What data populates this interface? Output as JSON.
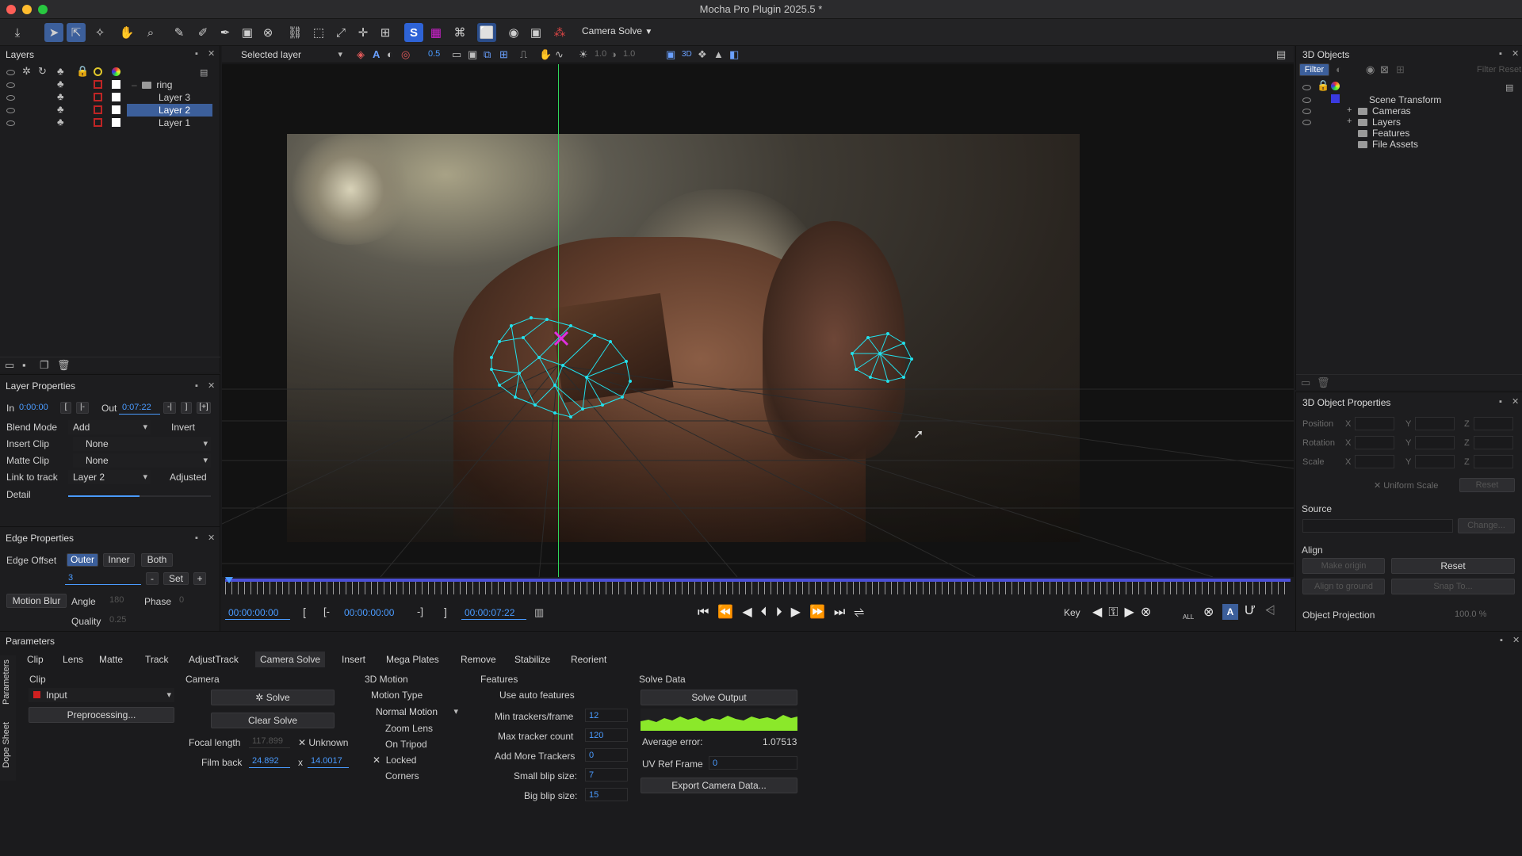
{
  "window": {
    "title": "Mocha Pro Plugin 2025.5 *"
  },
  "toolbar": {
    "module_select": "Camera Solve"
  },
  "viewer_bar": {
    "layer_select": "Selected layer",
    "opacity": "0.5",
    "val1": "1.0",
    "val2": "1.0"
  },
  "layers_panel": {
    "title": "Layers",
    "group": "ring",
    "layers": [
      {
        "name": "Layer 3",
        "selected": false
      },
      {
        "name": "Layer 2",
        "selected": true
      },
      {
        "name": "Layer 1",
        "selected": false
      }
    ]
  },
  "layer_properties": {
    "title": "Layer Properties",
    "in_label": "In",
    "in_value": "0:00:00",
    "out_label": "Out",
    "out_value": "0:07:22",
    "blend_mode_label": "Blend Mode",
    "blend_mode": "Add",
    "invert_label": "Invert",
    "insert_clip_label": "Insert Clip",
    "insert_clip": "None",
    "matte_clip_label": "Matte Clip",
    "matte_clip": "None",
    "link_label": "Link to track",
    "link_value": "Layer 2",
    "adjusted_label": "Adjusted",
    "detail_label": "Detail"
  },
  "edge_properties": {
    "title": "Edge Properties",
    "edge_offset_label": "Edge Offset",
    "outer": "Outer",
    "inner": "Inner",
    "both": "Both",
    "offset_value": "3",
    "minus": "-",
    "set": "Set",
    "plus": "+",
    "motion_blur": "Motion Blur",
    "angle_label": "Angle",
    "angle_value": "180",
    "phase_label": "Phase",
    "phase_value": "0",
    "quality_label": "Quality",
    "quality_value": "0.25"
  },
  "timeline": {
    "current": "00:00:00:00",
    "in": "00:00:00:00",
    "out": "00:00:07:22",
    "key_label": "Key",
    "all_label": "ALL"
  },
  "objects_3d": {
    "title": "3D Objects",
    "filter": "Filter",
    "filter_reset": "Filter Reset",
    "tree": [
      {
        "name": "Scene Transform",
        "level": 0
      },
      {
        "name": "Cameras",
        "level": 1
      },
      {
        "name": "Layers",
        "level": 1
      },
      {
        "name": "Features",
        "level": 1
      },
      {
        "name": "File Assets",
        "level": 1
      }
    ]
  },
  "object_properties": {
    "title": "3D Object Properties",
    "position": "Position",
    "rotation": "Rotation",
    "scale": "Scale",
    "x": "X",
    "y": "Y",
    "z": "Z",
    "uniform_scale": "Uniform Scale",
    "reset": "Reset",
    "source_label": "Source",
    "change": "Change...",
    "align_label": "Align",
    "make_origin": "Make origin",
    "align_reset": "Reset",
    "align_to_ground": "Align to ground",
    "snap_to": "Snap To...",
    "projection_label": "Object Projection",
    "projection_value": "100.0 %"
  },
  "parameters": {
    "title": "Parameters",
    "side_tabs": [
      "Parameters",
      "Dope Sheet"
    ],
    "tabs": [
      "Clip",
      "Lens",
      "Matte",
      "Track",
      "AdjustTrack",
      "Camera Solve",
      "Insert",
      "Mega Plates",
      "Remove",
      "Stabilize",
      "Reorient"
    ],
    "active_tab": "Camera Solve",
    "clip": {
      "label": "Clip",
      "input": "Input",
      "preprocessing": "Preprocessing..."
    },
    "camera": {
      "label": "Camera",
      "solve": "Solve",
      "clear": "Clear Solve",
      "focal_label": "Focal length",
      "focal_value": "117.899",
      "unknown": "Unknown",
      "film_label": "Film back",
      "film_w": "24.892",
      "x": "x",
      "film_h": "14.0017"
    },
    "motion": {
      "label": "3D Motion",
      "type_label": "Motion Type",
      "type_value": "Normal Motion",
      "zoom": "Zoom Lens",
      "tripod": "On Tripod",
      "locked": "Locked",
      "corners": "Corners"
    },
    "features": {
      "label": "Features",
      "auto": "Use auto features",
      "min_label": "Min trackers/frame",
      "min_value": "12",
      "max_label": "Max tracker count",
      "max_value": "120",
      "add_label": "Add More Trackers",
      "add_value": "0",
      "small_label": "Small blip size:",
      "small_value": "7",
      "big_label": "Big blip size:",
      "big_value": "15"
    },
    "solve_data": {
      "label": "Solve Data",
      "output": "Solve Output",
      "avg_label": "Average error:",
      "avg_value": "1.07513",
      "uv_label": "UV Ref Frame",
      "uv_value": "0",
      "export": "Export Camera Data..."
    }
  },
  "colors": {
    "accent": "#3c5f9b",
    "tracker": "#22e0ec",
    "field_text": "#4a9bff",
    "playhead": "#2fd65a"
  }
}
